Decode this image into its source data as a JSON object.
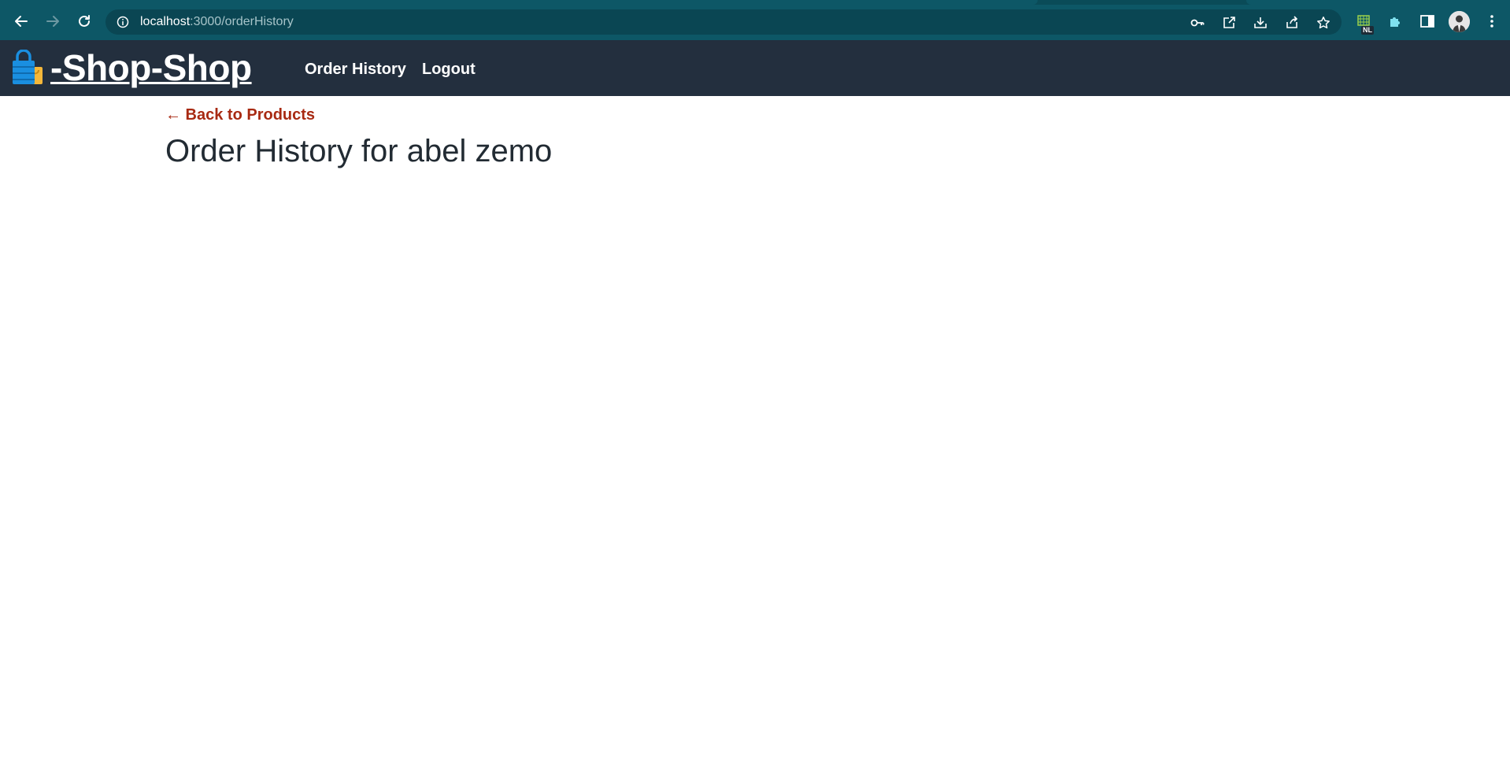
{
  "browser": {
    "url_host": "localhost",
    "url_path": ":3000/orderHistory",
    "extension_badge": "NL"
  },
  "site": {
    "logo_text": "-Shop-Shop",
    "nav": {
      "order_history": "Order History",
      "logout": "Logout"
    }
  },
  "main": {
    "back_link": "← Back to Products",
    "title": "Order History for abel zemo"
  },
  "colors": {
    "browser_bar": "#0d5766",
    "header_bg": "#232f3e",
    "back_link": "#a82a12",
    "title": "#222b33"
  }
}
